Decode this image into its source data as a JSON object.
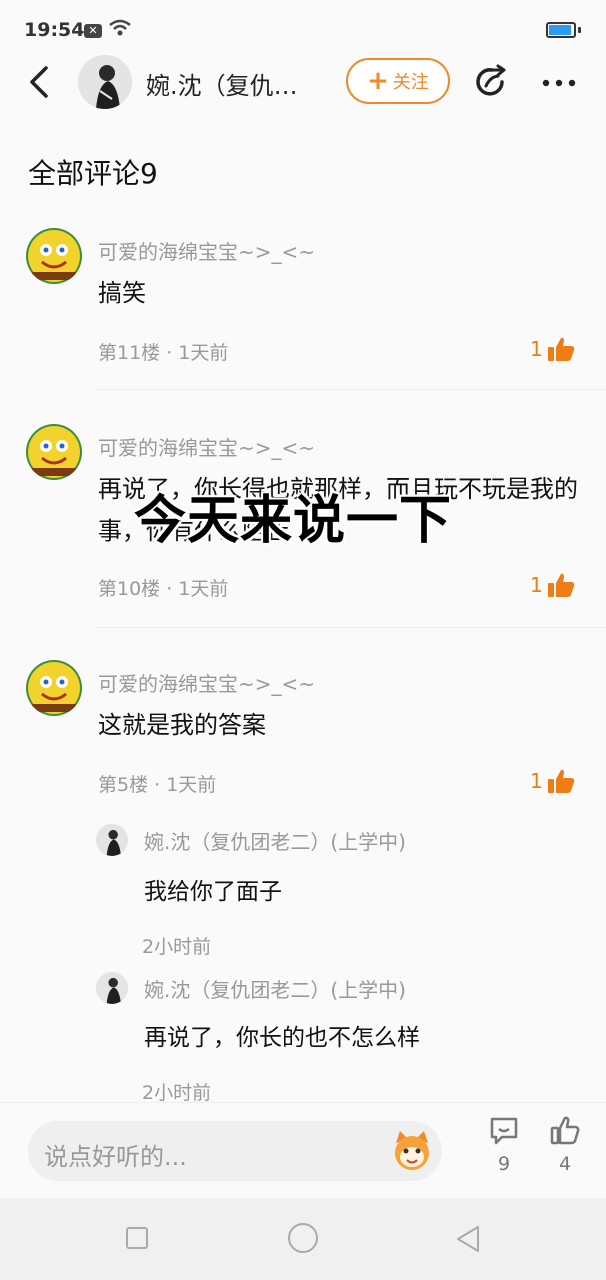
{
  "status": {
    "time": "19:54",
    "battery_percent": 90
  },
  "header": {
    "name": "婉.沈（复仇…",
    "follow_label": "关注"
  },
  "section_title": "全部评论9",
  "comments": [
    {
      "user": "可爱的海绵宝宝~>_<~",
      "text": "搞笑",
      "meta": "第11楼 · 1天前",
      "likes": "1"
    },
    {
      "user": "可爱的海绵宝宝~>_<~",
      "text": "再说了，你长得也就那样，而且玩不玩是我的事，你有什么阻止",
      "meta": "第10楼 · 1天前",
      "likes": "1"
    },
    {
      "user": "可爱的海绵宝宝~>_<~",
      "text": "这就是我的答案",
      "meta": "第5楼 · 1天前",
      "likes": "1"
    }
  ],
  "replies": [
    {
      "user": "婉.沈（复仇团老二）(上学中)",
      "text": "我给你了面子",
      "time": "2小时前"
    },
    {
      "user": "婉.沈（复仇团老二）(上学中)",
      "text": "再说了，你长的也不怎么样",
      "time": "2小时前"
    }
  ],
  "overlay_text": "今天来说一下",
  "bottom": {
    "input_placeholder": "说点好听的...",
    "comment_count": "9",
    "like_count": "4"
  },
  "colors": {
    "accent": "#ef8a2a",
    "like": "#ef7d16"
  }
}
